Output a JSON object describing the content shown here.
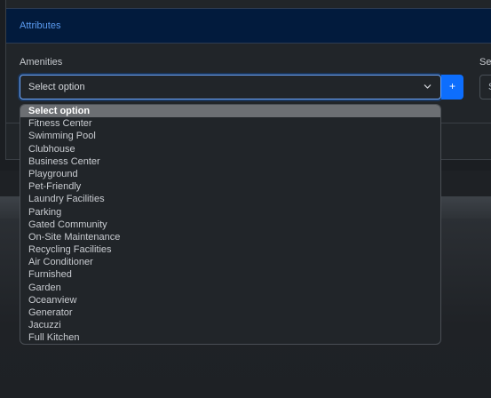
{
  "card": {
    "title": "Attributes"
  },
  "amenities": {
    "label": "Amenities",
    "value": "Select option",
    "add_label": "+"
  },
  "second_field": {
    "label": "Se",
    "value": "S"
  },
  "dropdown": {
    "options": [
      "Select option",
      "Fitness Center",
      "Swimming Pool",
      "Clubhouse",
      "Business Center",
      "Playground",
      "Pet-Friendly",
      "Laundry Facilities",
      "Parking",
      "Gated Community",
      "On-Site Maintenance",
      "Recycling Facilities",
      "Air Conditioner",
      "Furnished",
      "Garden",
      "Oceanview",
      "Generator",
      "Jacuzzi",
      "Full Kitchen"
    ],
    "selected_index": 0
  },
  "colors": {
    "header_bg": "#021b3d",
    "accent": "#0d6efd",
    "title_text": "#5b9bf0"
  }
}
